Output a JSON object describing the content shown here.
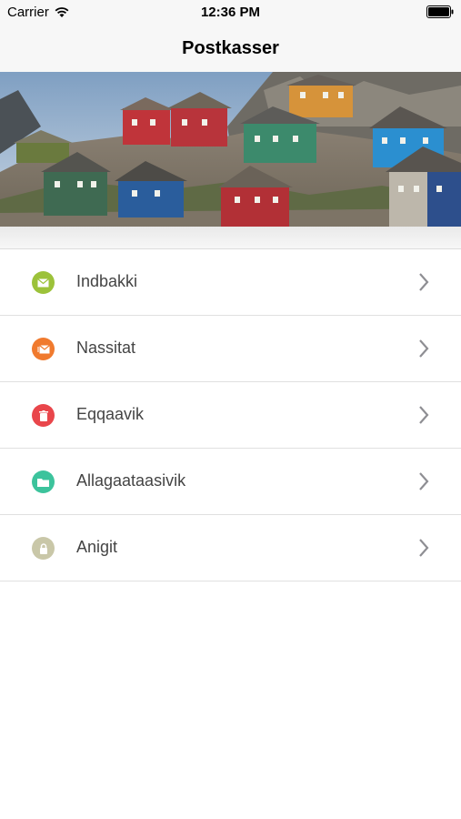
{
  "status_bar": {
    "carrier": "Carrier",
    "time": "12:36 PM"
  },
  "nav": {
    "title": "Postkasser"
  },
  "banner": {
    "description_icon": "greenland-houses-photo"
  },
  "mailboxes": [
    {
      "label": "Indbakki",
      "icon": "envelope-icon",
      "color": "#9cc23a"
    },
    {
      "label": "Nassitat",
      "icon": "send-icon",
      "color": "#f07a2e"
    },
    {
      "label": "Eqqaavik",
      "icon": "trash-icon",
      "color": "#e9464b"
    },
    {
      "label": "Allagaataasivik",
      "icon": "folder-icon",
      "color": "#3cc39c"
    },
    {
      "label": "Anigit",
      "icon": "lock-icon",
      "color": "#c9c7a8"
    }
  ]
}
